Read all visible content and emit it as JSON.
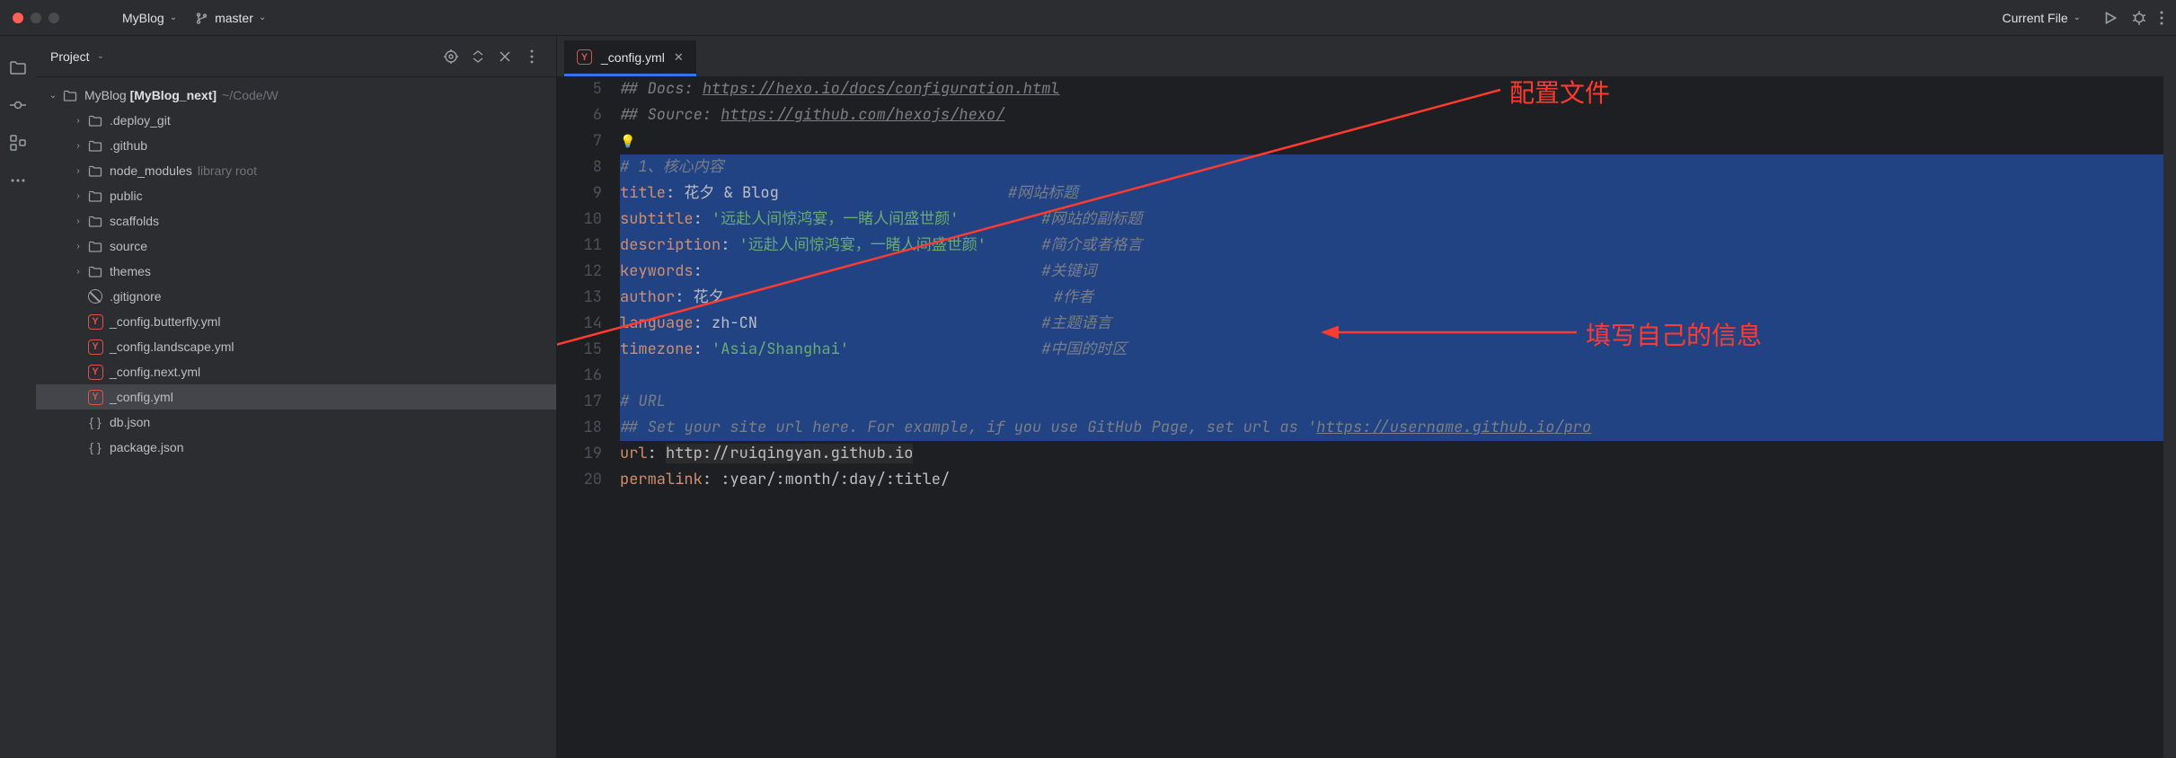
{
  "titlebar": {
    "project": "MyBlog",
    "branch": "master",
    "run_config": "Current File"
  },
  "sidebar": {
    "title": "Project",
    "root": {
      "name": "MyBlog",
      "bold": "[MyBlog_next]",
      "path": "~/Code/W"
    },
    "items": [
      {
        "name": ".deploy_git",
        "type": "folder",
        "depth": 1
      },
      {
        "name": ".github",
        "type": "folder",
        "depth": 1
      },
      {
        "name": "node_modules",
        "type": "folder",
        "depth": 1,
        "extra": "library root"
      },
      {
        "name": "public",
        "type": "folder",
        "depth": 1
      },
      {
        "name": "scaffolds",
        "type": "folder",
        "depth": 1
      },
      {
        "name": "source",
        "type": "folder",
        "depth": 1
      },
      {
        "name": "themes",
        "type": "folder",
        "depth": 1
      },
      {
        "name": ".gitignore",
        "type": "ignore",
        "depth": 1
      },
      {
        "name": "_config.butterfly.yml",
        "type": "yml",
        "depth": 1
      },
      {
        "name": "_config.landscape.yml",
        "type": "yml",
        "depth": 1
      },
      {
        "name": "_config.next.yml",
        "type": "yml",
        "depth": 1
      },
      {
        "name": "_config.yml",
        "type": "yml",
        "depth": 1,
        "selected": true
      },
      {
        "name": "db.json",
        "type": "json",
        "depth": 1
      },
      {
        "name": "package.json",
        "type": "json",
        "depth": 1
      }
    ]
  },
  "tab": {
    "label": "_config.yml"
  },
  "code": {
    "lines": [
      {
        "n": 5,
        "sel": false,
        "html": "<span class='c-comment'>## Docs: </span><span class='c-link'>https://hexo.io/docs/configuration.html</span>"
      },
      {
        "n": 6,
        "sel": false,
        "html": "<span class='c-comment'>## Source: </span><span class='c-link'>https://github.com/hexojs/hexo/</span>"
      },
      {
        "n": 7,
        "sel": false,
        "html": "<span class='bulb'>💡</span>"
      },
      {
        "n": 8,
        "sel": true,
        "html": "<span class='c-comment'># 1、核心内容</span>"
      },
      {
        "n": 9,
        "sel": true,
        "html": "<span class='c-key'>title</span><span class='c-val'>: 花夕 & Blog</span>                         <span class='c-comment'>#网站标题</span>"
      },
      {
        "n": 10,
        "sel": true,
        "html": "<span class='c-key'>subtitle</span><span class='c-val'>: </span><span class='c-str'>'远赴人间惊鸿宴，一睹人间盛世颜'</span>         <span class='c-comment'>#网站的副标题</span>"
      },
      {
        "n": 11,
        "sel": true,
        "html": "<span class='c-key'>description</span><span class='c-val'>: </span><span class='c-str'>'远赴人间惊鸿宴，一睹人间盛世颜'</span>      <span class='c-comment'>#简介或者格言</span>"
      },
      {
        "n": 12,
        "sel": true,
        "html": "<span class='c-key'>keywords</span><span class='c-val'>:</span>                                     <span class='c-comment'>#关键词</span>"
      },
      {
        "n": 13,
        "sel": true,
        "html": "<span class='c-key'>author</span><span class='c-val'>: 花夕</span>                                    <span class='c-comment'>#作者</span>"
      },
      {
        "n": 14,
        "sel": true,
        "html": "<span class='c-key'>language</span><span class='c-val'>: zh-CN</span>                               <span class='c-comment'>#主题语言</span>"
      },
      {
        "n": 15,
        "sel": true,
        "html": "<span class='c-key'>timezone</span><span class='c-val'>: </span><span class='c-str'>'Asia/Shanghai'</span>                     <span class='c-comment'>#中国的时区</span>"
      },
      {
        "n": 16,
        "sel": true,
        "html": ""
      },
      {
        "n": 17,
        "sel": true,
        "html": "<span class='c-comment'># URL</span>"
      },
      {
        "n": 18,
        "sel": true,
        "html": "<span class='c-comment'>## Set your site url here. For example, if you use GitHub Page, set url as '</span><span class='c-link'>https://username.github.io/pro</span>"
      },
      {
        "n": 19,
        "sel": false,
        "html": "<span class='c-key'>url</span><span class='c-val'>: </span><span class='c-url'>http://ruiqingyan.github.io</span>"
      },
      {
        "n": 20,
        "sel": false,
        "html": "<span class='c-key'>permalink</span><span class='c-val'>: :year/:month/:day/:title/</span>"
      }
    ]
  },
  "annotations": {
    "a1": "配置文件",
    "a2": "填写自己的信息"
  }
}
